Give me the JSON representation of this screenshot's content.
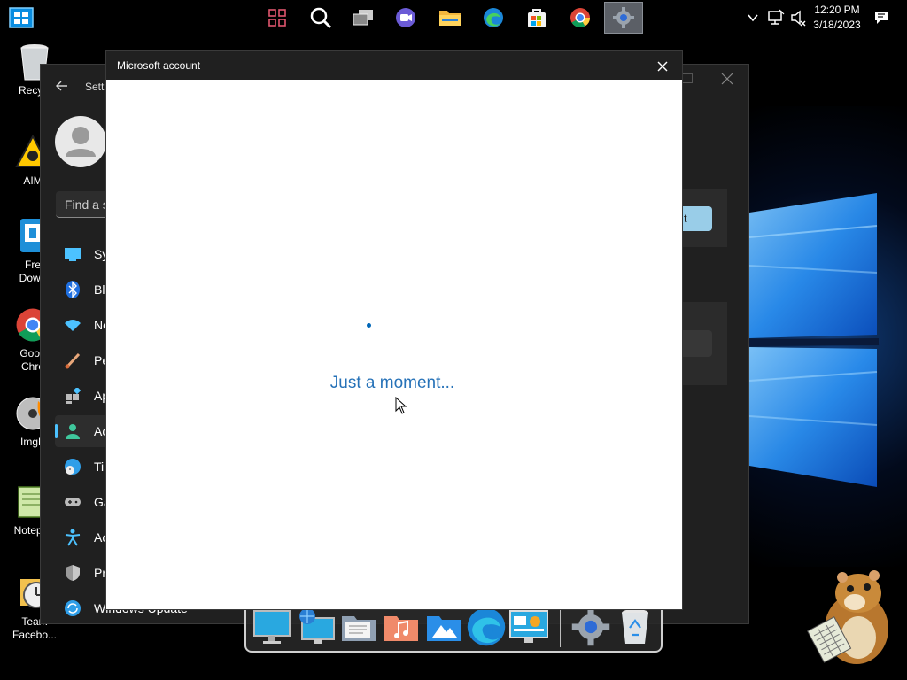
{
  "taskbar": {
    "icons": [
      "widgets-icon",
      "search-icon",
      "task-view-icon",
      "teams-chat-icon",
      "file-explorer-icon",
      "edge-icon",
      "store-icon",
      "chrome-icon",
      "settings-icon"
    ],
    "clock": {
      "time": "12:20 PM",
      "date": "3/18/2023"
    }
  },
  "desktop": {
    "icons": [
      {
        "label_line1": "Recycl",
        "label_line2": ""
      },
      {
        "label_line1": "AIM",
        "label_line2": ""
      },
      {
        "label_line1": "Fre",
        "label_line2": "Down"
      },
      {
        "label_line1": "Goog",
        "label_line2": "Chro"
      },
      {
        "label_line1": "ImgB",
        "label_line2": ""
      },
      {
        "label_line1": "Notepa",
        "label_line2": ""
      },
      {
        "label_line1": "Team",
        "label_line2": "Facebo..."
      }
    ]
  },
  "settings": {
    "title": "Setti",
    "search_placeholder": "Find a s",
    "nav": [
      {
        "label": "Sy",
        "icon": "system-icon"
      },
      {
        "label": "Blu",
        "icon": "bluetooth-icon"
      },
      {
        "label": "Ne",
        "icon": "network-icon"
      },
      {
        "label": "Pe",
        "icon": "personalization-icon"
      },
      {
        "label": "Ap",
        "icon": "apps-icon"
      },
      {
        "label": "Ac",
        "icon": "accounts-icon",
        "selected": true
      },
      {
        "label": "Tin",
        "icon": "time-language-icon"
      },
      {
        "label": "Ga",
        "icon": "gaming-icon"
      },
      {
        "label": "Ac",
        "icon": "accessibility-icon"
      },
      {
        "label": "Pri",
        "icon": "privacy-icon"
      },
      {
        "label": "Windows Update",
        "icon": "windows-update-icon"
      }
    ],
    "right_button_text": "t"
  },
  "dialog": {
    "title": "Microsoft account",
    "loading_text": "Just a moment..."
  },
  "dock": {
    "icons": [
      "monitor-icon",
      "network-computer-icon",
      "documents-icon",
      "music-icon",
      "pictures-icon",
      "edge-dock-icon",
      "control-panel-icon",
      "settings-dock-icon",
      "recycle-bin-dock-icon"
    ]
  },
  "colors": {
    "accent": "#0067b8",
    "loading_text": "#2672b8",
    "settings_bg": "#202020",
    "selection_accent": "#4cc2ff"
  }
}
